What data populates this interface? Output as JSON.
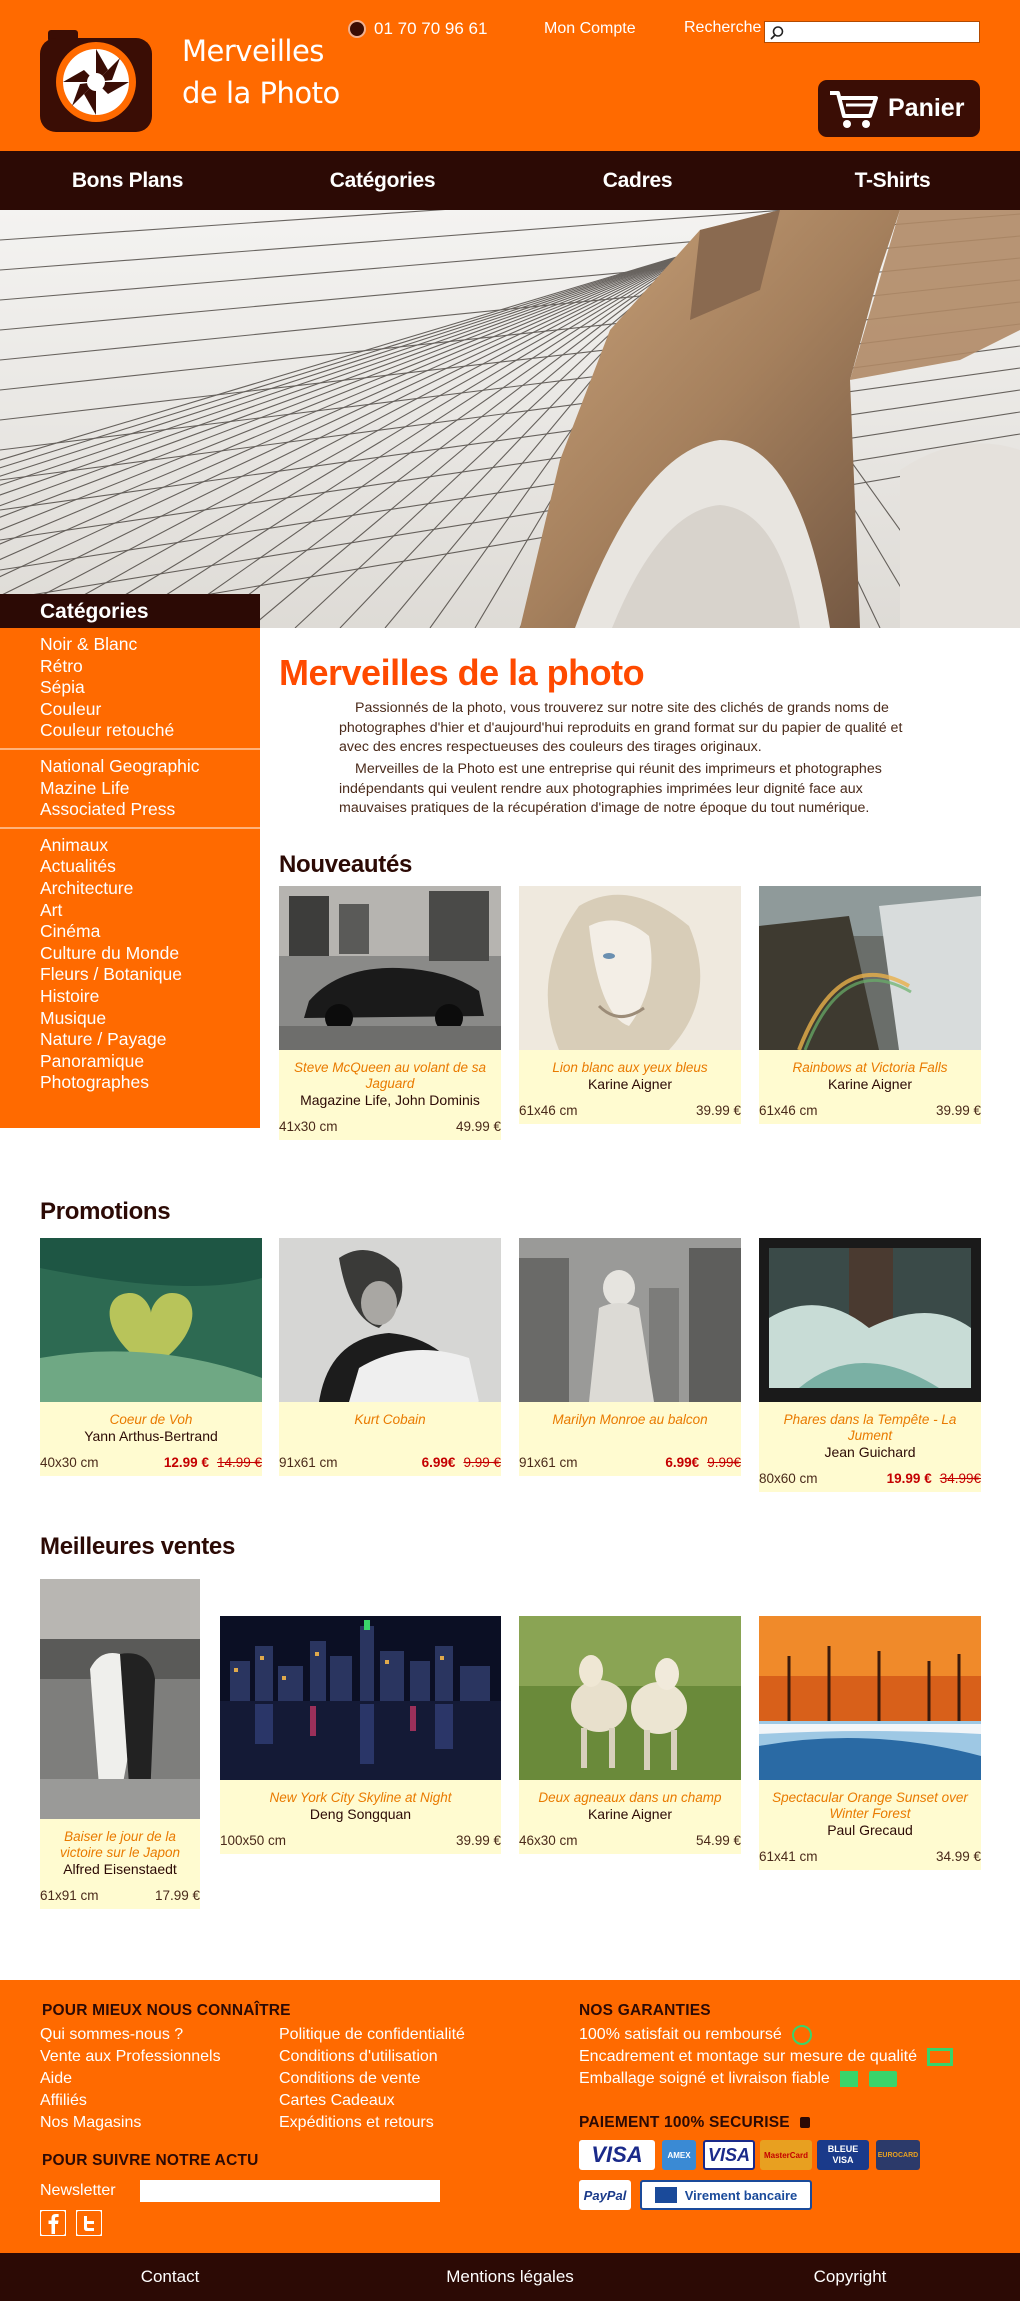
{
  "header": {
    "logo_line1": "Merveilles",
    "logo_line2": "de la Photo",
    "phone": "01 70 70 96 61",
    "account": "Mon Compte",
    "search_label": "Recherche",
    "search_value": "",
    "cart_label": "Panier",
    "brand_orange": "#ff6a00",
    "brand_dark": "#2c0a05"
  },
  "nav": [
    "Bons Plans",
    "Catégories",
    "Cadres",
    "T-Shirts"
  ],
  "sidebar": {
    "title": "Catégories",
    "groups": [
      [
        "Noir & Blanc",
        "Rétro",
        "Sépia",
        "Couleur",
        "Couleur retouché"
      ],
      [
        "National Geographic",
        "Mazine Life",
        "Associated Press"
      ],
      [
        "Animaux",
        "Actualités",
        "Architecture",
        "Art",
        "Cinéma",
        "Culture du Monde",
        "Fleurs / Botanique",
        "Histoire",
        "Musique",
        "Nature / Payage",
        "Panoramique",
        "Photographes"
      ]
    ]
  },
  "intro": {
    "title": "Merveilles de la photo",
    "p1": "Passionnés de la photo, vous trouverez sur notre site des clichés de grands noms de photographes d'hier et d'aujourd'hui reproduits en grand format sur du papier de qualité et avec des encres respectueuses des couleurs des tirages originaux.",
    "p2": "Merveilles de la Photo est une entreprise qui réunit des imprimeurs et photographes indépendants qui veulent rendre aux photographies imprimées leur dignité face aux mauvaises pratiques de la récupération d'image de notre époque du tout numérique."
  },
  "nouveautes": {
    "title": "Nouveautés",
    "items": [
      {
        "title": "Steve McQueen au volant de sa Jaguard",
        "artist": "Magazine Life, John Dominis",
        "size": "41x30 cm",
        "price": "49.99 €"
      },
      {
        "title": "Lion blanc aux yeux bleus",
        "artist": "Karine Aigner",
        "size": "61x46 cm",
        "price": "39.99 €"
      },
      {
        "title": "Rainbows at Victoria Falls",
        "artist": "Karine Aigner",
        "size": "61x46 cm",
        "price": "39.99 €"
      }
    ]
  },
  "promotions": {
    "title": "Promotions",
    "items": [
      {
        "title": "Coeur de Voh",
        "artist": "Yann Arthus-Bertrand",
        "size": "40x30 cm",
        "price": "12.99 €",
        "old": "14.99 €"
      },
      {
        "title": "Kurt Cobain",
        "artist": "",
        "size": "91x61 cm",
        "price": "6.99€",
        "old": "9.99 €"
      },
      {
        "title": "Marilyn Monroe au balcon",
        "artist": "",
        "size": "91x61 cm",
        "price": "6.99€",
        "old": "9.99€"
      },
      {
        "title": "Phares dans la Tempête - La Jument",
        "artist": "Jean Guichard",
        "size": "80x60 cm",
        "price": "19.99 €",
        "old": "34.99€"
      }
    ]
  },
  "meilleures": {
    "title": "Meilleures ventes",
    "items": [
      {
        "title": "Baiser le jour de la victoire sur le Japon",
        "artist": "Alfred Eisenstaedt",
        "size": "61x91 cm",
        "price": "17.99 €"
      },
      {
        "title": "New York City Skyline at Night",
        "artist": "Deng Songquan",
        "size": "100x50 cm",
        "price": "39.99 €"
      },
      {
        "title": "Deux agneaux dans un champ",
        "artist": "Karine Aigner",
        "size": "46x30 cm",
        "price": "54.99 €"
      },
      {
        "title": "Spectacular Orange Sunset over Winter Forest",
        "artist": "Paul Grecaud",
        "size": "61x41 cm",
        "price": "34.99 €"
      }
    ]
  },
  "footer": {
    "know_title": "POUR MIEUX NOUS CONNAÎTRE",
    "col1": [
      "Qui sommes-nous ?",
      "Vente aux Professionnels",
      "Aide",
      "Affiliés",
      "Nos Magasins"
    ],
    "col2": [
      "Politique de confidentialité",
      "Conditions d'utilisation",
      "Conditions de vente",
      "Cartes Cadeaux",
      "Expéditions et retours"
    ],
    "news_title": "POUR SUIVRE NOTRE ACTU",
    "newsletter_label": "Newsletter",
    "guarantee_title": "NOS GARANTIES",
    "guarantees": [
      "100% satisfait ou remboursé",
      "Encadrement et montage sur mesure de qualité",
      "Emballage soigné et livraison fiable"
    ],
    "payment_title": "PAIEMENT 100% SECURISE",
    "cards": [
      "VISA",
      "AMEX",
      "VISA",
      "MasterCard",
      "BLEUE VISA",
      "EUROCARD"
    ],
    "paypal": "PayPal",
    "bank": "Virement bancaire"
  },
  "bottom": [
    "Contact",
    "Mentions légales",
    "Copyright"
  ]
}
